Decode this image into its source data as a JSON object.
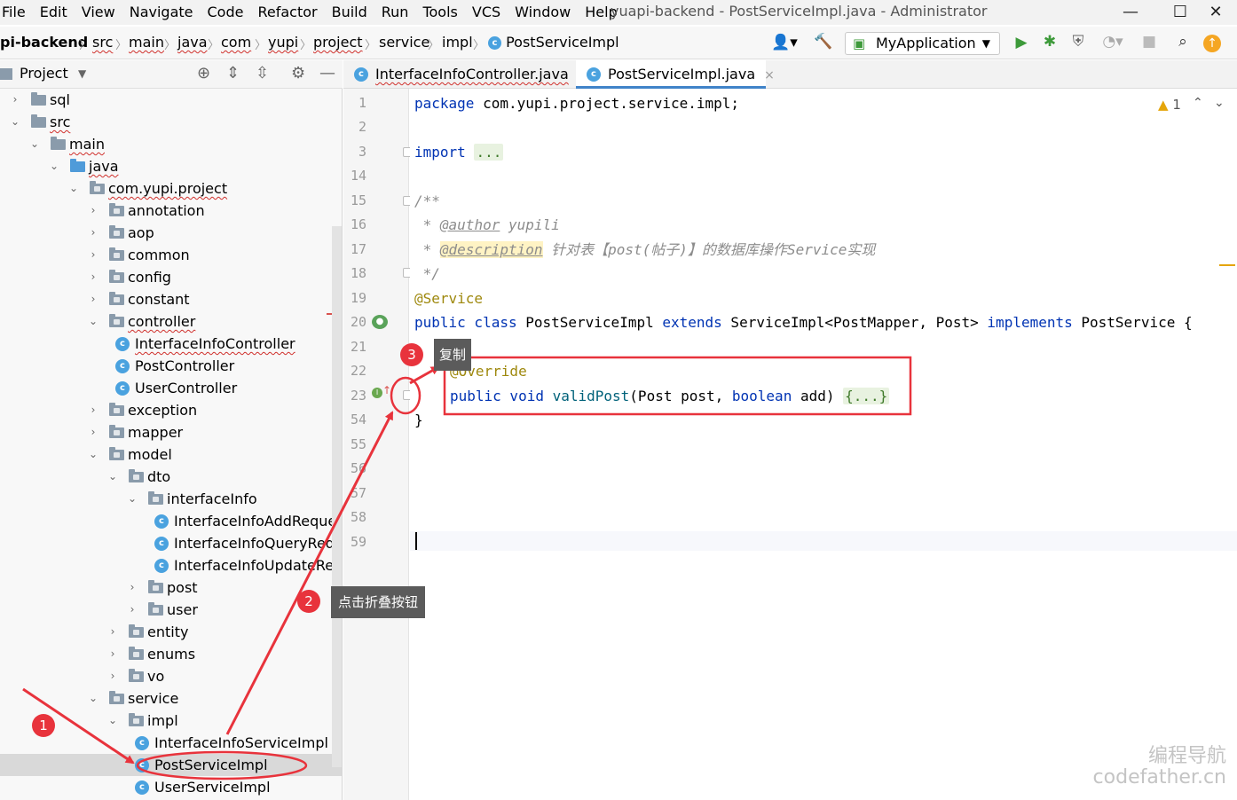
{
  "menu": [
    "File",
    "Edit",
    "View",
    "Navigate",
    "Code",
    "Refactor",
    "Build",
    "Run",
    "Tools",
    "VCS",
    "Window",
    "Help"
  ],
  "window_title": "yuapi-backend - PostServiceImpl.java - Administrator",
  "breadcrumb": {
    "project": "pi-backend",
    "items": [
      "src",
      "main",
      "java",
      "com",
      "yupi",
      "project",
      "service",
      "impl"
    ],
    "current": "PostServiceImpl"
  },
  "run_config": "MyApplication",
  "project_panel": {
    "title": "Project"
  },
  "tree": [
    {
      "label": "sql",
      "chev": "›",
      "kind": "folder"
    },
    {
      "label": "src",
      "chev": "⌄",
      "kind": "folder"
    },
    {
      "label": "main",
      "chev": "⌄",
      "kind": "folder"
    },
    {
      "label": "java",
      "chev": "⌄",
      "kind": "folder-blue"
    },
    {
      "label": "com.yupi.project",
      "chev": "⌄",
      "kind": "package"
    },
    {
      "label": "annotation",
      "chev": "›",
      "kind": "package"
    },
    {
      "label": "aop",
      "chev": "›",
      "kind": "package"
    },
    {
      "label": "common",
      "chev": "›",
      "kind": "package"
    },
    {
      "label": "config",
      "chev": "›",
      "kind": "package"
    },
    {
      "label": "constant",
      "chev": "›",
      "kind": "package"
    },
    {
      "label": "controller",
      "chev": "⌄",
      "kind": "package"
    },
    {
      "label": "InterfaceInfoController",
      "chev": "",
      "kind": "class"
    },
    {
      "label": "PostController",
      "chev": "",
      "kind": "class"
    },
    {
      "label": "UserController",
      "chev": "",
      "kind": "class"
    },
    {
      "label": "exception",
      "chev": "›",
      "kind": "package"
    },
    {
      "label": "mapper",
      "chev": "›",
      "kind": "package"
    },
    {
      "label": "model",
      "chev": "⌄",
      "kind": "package"
    },
    {
      "label": "dto",
      "chev": "⌄",
      "kind": "package"
    },
    {
      "label": "interfaceInfo",
      "chev": "⌄",
      "kind": "package"
    },
    {
      "label": "InterfaceInfoAddReque",
      "chev": "",
      "kind": "class"
    },
    {
      "label": "InterfaceInfoQueryRequ",
      "chev": "",
      "kind": "class"
    },
    {
      "label": "InterfaceInfoUpdateRec",
      "chev": "",
      "kind": "class"
    },
    {
      "label": "post",
      "chev": "›",
      "kind": "package"
    },
    {
      "label": "user",
      "chev": "›",
      "kind": "package"
    },
    {
      "label": "entity",
      "chev": "›",
      "kind": "package"
    },
    {
      "label": "enums",
      "chev": "›",
      "kind": "package"
    },
    {
      "label": "vo",
      "chev": "›",
      "kind": "package"
    },
    {
      "label": "service",
      "chev": "⌄",
      "kind": "package"
    },
    {
      "label": "impl",
      "chev": "⌄",
      "kind": "package"
    },
    {
      "label": "InterfaceInfoServiceImpl",
      "chev": "",
      "kind": "class"
    },
    {
      "label": "PostServiceImpl",
      "chev": "",
      "kind": "class"
    },
    {
      "label": "UserServiceImpl",
      "chev": "",
      "kind": "class"
    }
  ],
  "tabs": [
    {
      "label": "InterfaceInfoController.java",
      "close": "×"
    },
    {
      "label": "PostServiceImpl.java",
      "close": "×"
    }
  ],
  "line_numbers": [
    "1",
    "2",
    "3",
    "14",
    "15",
    "16",
    "17",
    "18",
    "19",
    "20",
    "21",
    "22",
    "23",
    "54",
    "55",
    "56",
    "57",
    "58",
    "59"
  ],
  "code": {
    "l1_kw": "package",
    "l1_rest": " com.yupi.project.service.impl;",
    "l3_kw": "import",
    "l3_fold": "...",
    "l15": "/**",
    "l16_star": " * ",
    "l16_tag": "@author",
    "l16_text": " yupili",
    "l17_star": " * ",
    "l17_tag": "@description",
    "l17_text": " 针对表【post(帖子)】的数据库操作Service实现",
    "l18": " */",
    "l19": "@Service",
    "l20_a": "public class",
    "l20_b": " PostServiceImpl ",
    "l20_c": "extends",
    "l20_d": " ServiceImpl<PostMapper, Post> ",
    "l20_e": "implements",
    "l20_f": " PostService {",
    "l22": "@Override",
    "l23_a": "public void",
    "l23_m": " validPost",
    "l23_b": "(Post post, ",
    "l23_c": "boolean",
    "l23_d": " add) ",
    "l23_fold": "{...}",
    "l54": "}"
  },
  "inspection": {
    "warnings": "1"
  },
  "annotations": {
    "badge1": "1",
    "badge2": "2",
    "badge3": "3",
    "tip2": "点击折叠按钮",
    "tip3": "复制"
  },
  "watermark": {
    "line1": "编程导航",
    "line2": "codefather.cn"
  },
  "colors": {
    "accent": "#e8333c",
    "keyword": "#0033b3",
    "annotation": "#9e880d"
  }
}
